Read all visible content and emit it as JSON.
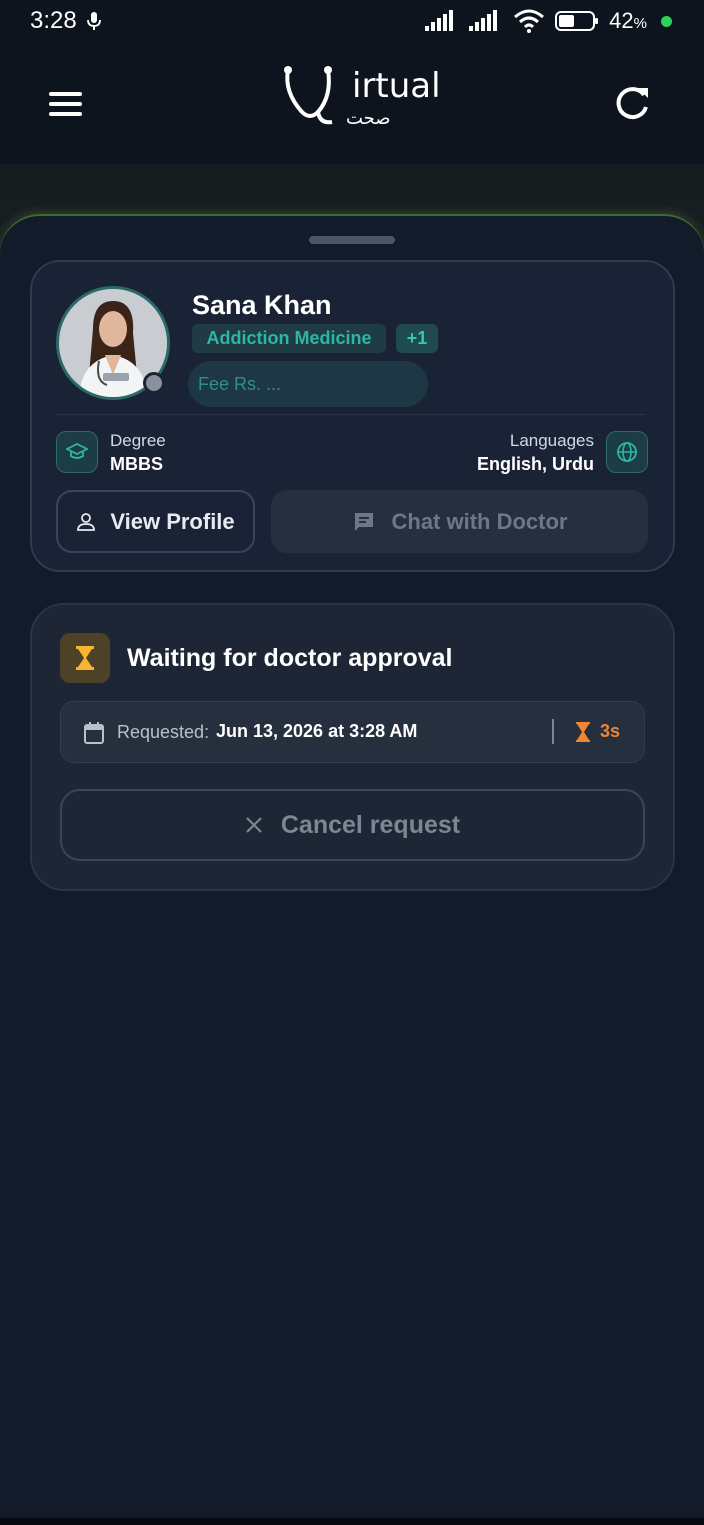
{
  "status_bar": {
    "time": "3:28",
    "battery_pct": "42",
    "battery_unit": "%"
  },
  "header": {
    "logo_text": "irtual",
    "logo_subtext": "صحت"
  },
  "doctor": {
    "name": "Sana Khan",
    "specialty": "Addiction Medicine",
    "more_specialties": "+1",
    "fee": "Fee  Rs. ...",
    "degree_label": "Degree",
    "degree_value": "MBBS",
    "languages_label": "Languages",
    "languages_value": "English, Urdu",
    "view_profile_label": "View Profile",
    "chat_label": "Chat with Doctor"
  },
  "request": {
    "status_title": "Waiting for doctor approval",
    "requested_label": "Requested:",
    "requested_value": "Jun 13, 2026 at 3:28 AM",
    "elapsed": "3s",
    "cancel_label": "Cancel request"
  },
  "colors": {
    "accent_teal": "#2fb5a4",
    "warning_orange": "#f08430",
    "background": "#121a29"
  }
}
